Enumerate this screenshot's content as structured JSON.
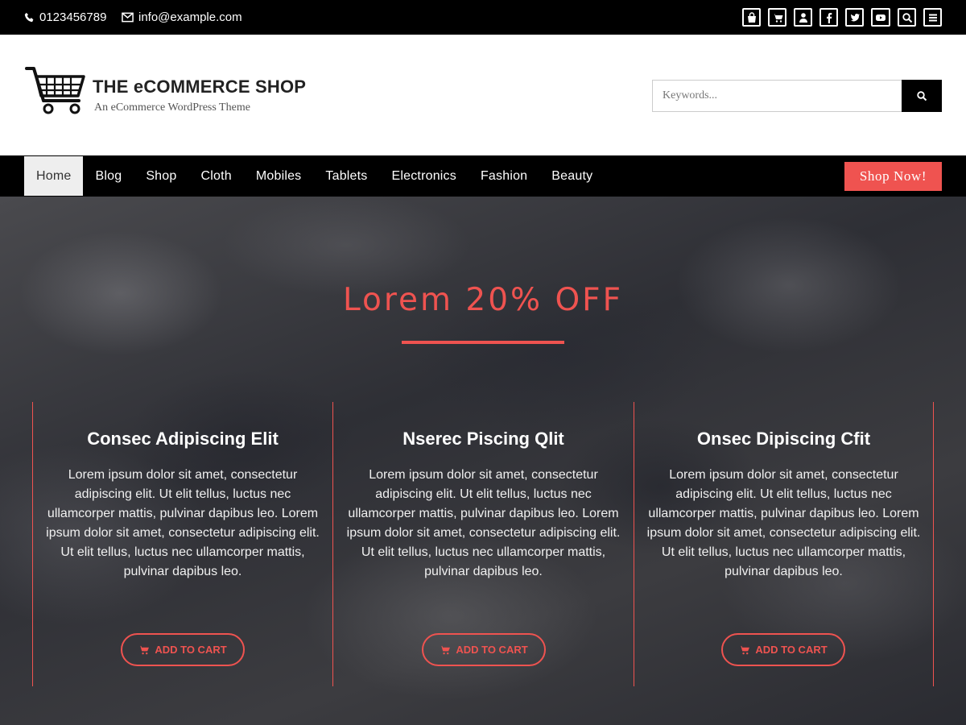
{
  "topbar": {
    "phone": "0123456789",
    "email": "info@example.com",
    "icons": [
      "bag-icon",
      "cart-icon",
      "user-icon",
      "facebook-icon",
      "twitter-icon",
      "youtube-icon",
      "search-icon",
      "menu-icon"
    ]
  },
  "header": {
    "logo_title": "THE eCOMMERCE SHOP",
    "logo_tagline": "An eCommerce WordPress Theme",
    "search_placeholder": "Keywords..."
  },
  "nav": {
    "items": [
      "Home",
      "Blog",
      "Shop",
      "Cloth",
      "Mobiles",
      "Tablets",
      "Electronics",
      "Fashion",
      "Beauty"
    ],
    "active": "Home",
    "cta": "Shop Now!"
  },
  "hero": {
    "title": "Lorem 20% OFF",
    "cards": [
      {
        "title": "Consec Adipiscing Elit",
        "text": "Lorem ipsum dolor sit amet, consectetur adipiscing elit. Ut elit tellus, luctus nec ullamcorper mattis, pulvinar dapibus leo. Lorem ipsum dolor sit amet, consectetur adipiscing elit. Ut elit tellus, luctus nec ullamcorper mattis, pulvinar dapibus leo.",
        "button": "ADD TO CART"
      },
      {
        "title": "Nserec Piscing Qlit",
        "text": "Lorem ipsum dolor sit amet, consectetur adipiscing elit. Ut elit tellus, luctus nec ullamcorper mattis, pulvinar dapibus leo. Lorem ipsum dolor sit amet, consectetur adipiscing elit. Ut elit tellus, luctus nec ullamcorper mattis, pulvinar dapibus leo.",
        "button": "ADD TO CART"
      },
      {
        "title": "Onsec Dipiscing Cfit",
        "text": "Lorem ipsum dolor sit amet, consectetur adipiscing elit. Ut elit tellus, luctus nec ullamcorper mattis, pulvinar dapibus leo. Lorem ipsum dolor sit amet, consectetur adipiscing elit. Ut elit tellus, luctus nec ullamcorper mattis, pulvinar dapibus leo.",
        "button": "ADD TO CART"
      }
    ]
  },
  "colors": {
    "accent": "#ef5350",
    "topbar_bg": "#000000",
    "nav_active_bg": "#eeeeee"
  }
}
